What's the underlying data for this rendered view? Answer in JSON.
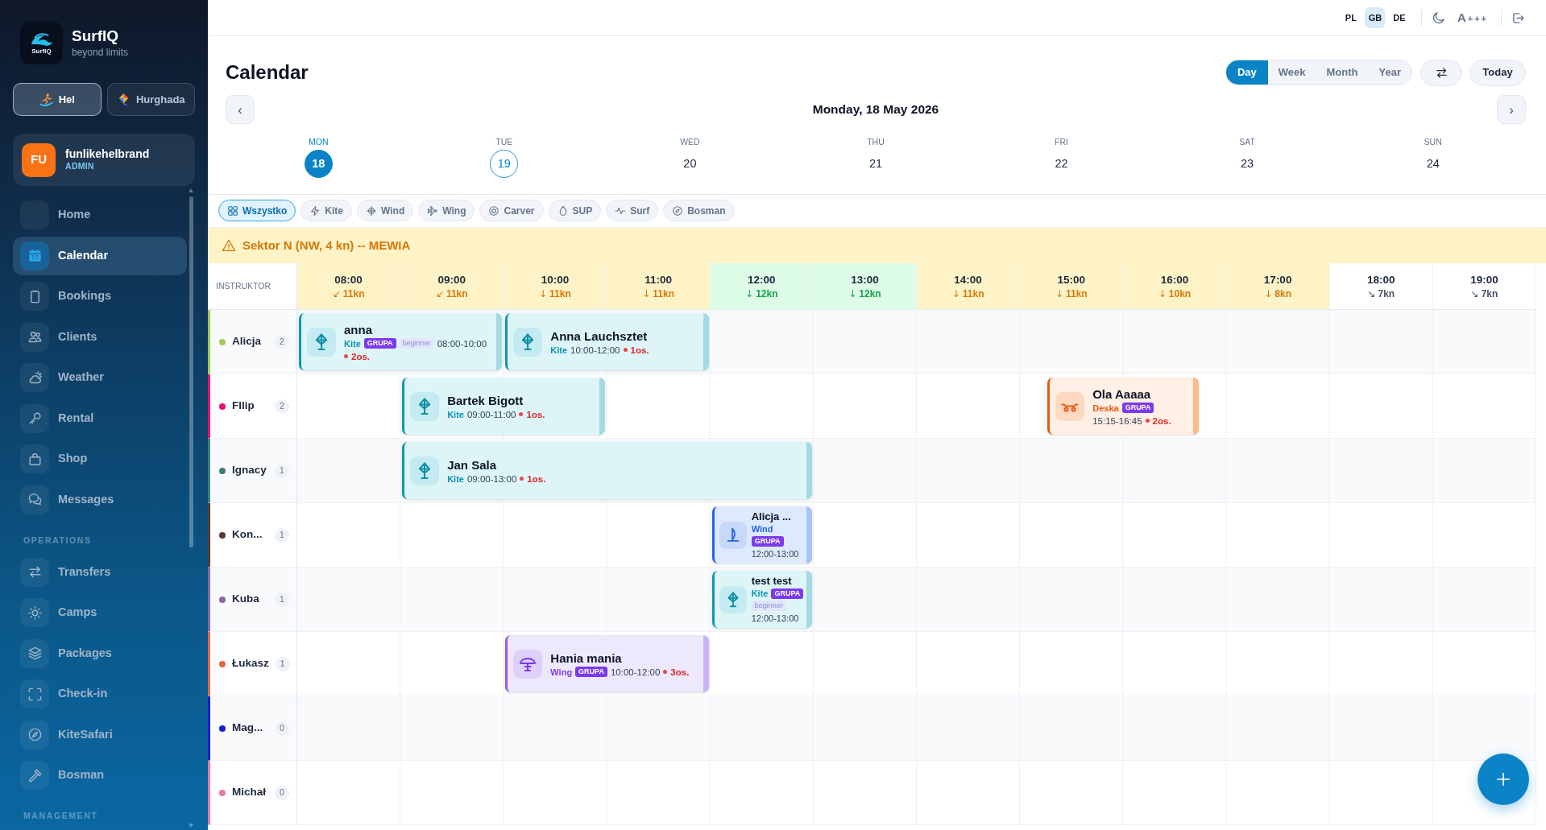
{
  "sidebar": {
    "brand": {
      "logo_text": "SurfIQ",
      "name": "SurfIQ",
      "tagline": "beyond limits"
    },
    "locations": [
      {
        "label": "Hel",
        "selected": true
      },
      {
        "label": "Hurghada",
        "selected": false
      }
    ],
    "user": {
      "initials": "FU",
      "name": "funlikehelbrand",
      "role": "ADMIN"
    },
    "nav": [
      {
        "items": [
          {
            "label": "Home",
            "selected": false
          },
          {
            "label": "Calendar",
            "selected": true
          },
          {
            "label": "Bookings",
            "selected": false
          },
          {
            "label": "Clients",
            "selected": false
          },
          {
            "label": "Weather",
            "selected": false
          },
          {
            "label": "Rental",
            "selected": false
          },
          {
            "label": "Shop",
            "selected": false
          },
          {
            "label": "Messages",
            "selected": false
          }
        ]
      },
      {
        "heading": "OPERATIONS",
        "items": [
          {
            "label": "Transfers",
            "selected": false
          },
          {
            "label": "Camps",
            "selected": false
          },
          {
            "label": "Packages",
            "selected": false
          },
          {
            "label": "Check-in",
            "selected": false
          },
          {
            "label": "KiteSafari",
            "selected": false
          },
          {
            "label": "Bosman",
            "selected": false
          }
        ]
      },
      {
        "heading": "MANAGEMENT"
      }
    ]
  },
  "topbar": {
    "languages": [
      {
        "code": "PL",
        "selected": false
      },
      {
        "code": "GB",
        "selected": true
      },
      {
        "code": "DE",
        "selected": false
      }
    ],
    "font_size": {
      "letter": "A",
      "steps": "+++"
    }
  },
  "header": {
    "title": "Calendar",
    "views": [
      {
        "label": "Day",
        "selected": true
      },
      {
        "label": "Week",
        "selected": false
      },
      {
        "label": "Month",
        "selected": false
      },
      {
        "label": "Year",
        "selected": false
      }
    ],
    "today": "Today",
    "prev": "‹",
    "date": "Monday, 18 May 2026",
    "next": "›"
  },
  "days": [
    {
      "weekday": "MON",
      "date": "18",
      "selected": true,
      "today": false
    },
    {
      "weekday": "TUE",
      "date": "19",
      "selected": false,
      "today": true
    },
    {
      "weekday": "WED",
      "date": "20",
      "selected": false,
      "today": false
    },
    {
      "weekday": "THU",
      "date": "21",
      "selected": false,
      "today": false
    },
    {
      "weekday": "FRI",
      "date": "22",
      "selected": false,
      "today": false
    },
    {
      "weekday": "SAT",
      "date": "23",
      "selected": false,
      "today": false
    },
    {
      "weekday": "SUN",
      "date": "24",
      "selected": false,
      "today": false
    }
  ],
  "filters": [
    {
      "label": "Wszystko",
      "selected": true
    },
    {
      "label": "Kite",
      "selected": false
    },
    {
      "label": "Wind",
      "selected": false
    },
    {
      "label": "Wing",
      "selected": false
    },
    {
      "label": "Carver",
      "selected": false
    },
    {
      "label": "SUP",
      "selected": false
    },
    {
      "label": "Surf",
      "selected": false
    },
    {
      "label": "Bosman",
      "selected": false
    }
  ],
  "alert": {
    "text": "Sektor N (NW, 4 kn) -- MEWIA"
  },
  "schedule": {
    "column_label": "INSTRUKTOR",
    "hours": [
      {
        "time": "08:00",
        "arrow": "↙",
        "wind": "11kn",
        "color": "#d97706"
      },
      {
        "time": "09:00",
        "arrow": "↙",
        "wind": "11kn",
        "color": "#d97706"
      },
      {
        "time": "10:00",
        "arrow": "↓",
        "wind": "11kn",
        "color": "#d97706"
      },
      {
        "time": "11:00",
        "arrow": "↓",
        "wind": "11kn",
        "color": "#d97706"
      },
      {
        "time": "12:00",
        "arrow": "↓",
        "wind": "12kn",
        "color": "#16a34a"
      },
      {
        "time": "13:00",
        "arrow": "↓",
        "wind": "12kn",
        "color": "#16a34a"
      },
      {
        "time": "14:00",
        "arrow": "↓",
        "wind": "11kn",
        "color": "#d97706"
      },
      {
        "time": "15:00",
        "arrow": "↓",
        "wind": "11kn",
        "color": "#d97706"
      },
      {
        "time": "16:00",
        "arrow": "↓",
        "wind": "10kn",
        "color": "#d97706"
      },
      {
        "time": "17:00",
        "arrow": "↓",
        "wind": "8kn",
        "color": "#d97706"
      },
      {
        "time": "18:00",
        "arrow": "↘",
        "wind": "7kn",
        "color": "#475569"
      },
      {
        "time": "19:00",
        "arrow": "↘",
        "wind": "7kn",
        "color": "#475569"
      }
    ],
    "instructors": [
      {
        "name": "Alicja",
        "color": "#a3c957",
        "count": "2",
        "events": [
          {
            "kind": "kite",
            "title": "anna",
            "sport": "Kite",
            "badges": [
              {
                "text": "GRUPA",
                "kind": "group"
              },
              {
                "text": "beginner",
                "kind": "level"
              }
            ],
            "time": "08:00-10:00",
            "people": "2os."
          },
          {
            "kind": "kite",
            "title": "Anna Lauchsztet",
            "sport": "Kite",
            "time": "10:00-12:00",
            "people": "1os."
          }
        ]
      },
      {
        "name": "FIlip",
        "color": "#e8116f",
        "count": "2",
        "events": [
          {
            "kind": "kite",
            "title": "Bartek Bigott",
            "sport": "Kite",
            "time": "09:00-11:00",
            "people": "1os."
          },
          {
            "kind": "board",
            "title": "Ola Aaaaa",
            "sport": "Deska",
            "badges": [
              {
                "text": "GRUPA",
                "kind": "group"
              }
            ],
            "time": "15:15-16:45",
            "people": "2os."
          }
        ]
      },
      {
        "name": "Ignacy",
        "color": "#3e7d78",
        "count": "1",
        "events": [
          {
            "kind": "kite",
            "title": "Jan Sala",
            "sport": "Kite",
            "time": "09:00-13:00",
            "people": "1os."
          }
        ]
      },
      {
        "name": "Kon...",
        "color": "#5a3a33",
        "count": "1",
        "events": [
          {
            "kind": "wind",
            "title": "Alicja ...",
            "sport": "Wind",
            "badges": [
              {
                "text": "GRUPA",
                "kind": "group"
              }
            ],
            "time": "12:00-13:00"
          }
        ]
      },
      {
        "name": "Kuba",
        "color": "#8a67a3",
        "count": "1",
        "events": [
          {
            "kind": "kite",
            "title": "test test",
            "sport": "Kite",
            "badges": [
              {
                "text": "GRUPA",
                "kind": "group"
              },
              {
                "text": "beginner",
                "kind": "level"
              }
            ],
            "time": "12:00-13:00"
          }
        ]
      },
      {
        "name": "Łukasz",
        "color": "#e0674a",
        "count": "1",
        "events": [
          {
            "kind": "wing",
            "title": "Hania mania",
            "sport": "Wing",
            "badges": [
              {
                "text": "GRUPA",
                "kind": "group"
              }
            ],
            "time": "10:00-12:00",
            "people": "3os."
          }
        ]
      },
      {
        "name": "Mag...",
        "color": "#1c1fcf",
        "count": "0"
      },
      {
        "name": "Michał",
        "color": "#e87aa6",
        "count": "0"
      }
    ]
  }
}
